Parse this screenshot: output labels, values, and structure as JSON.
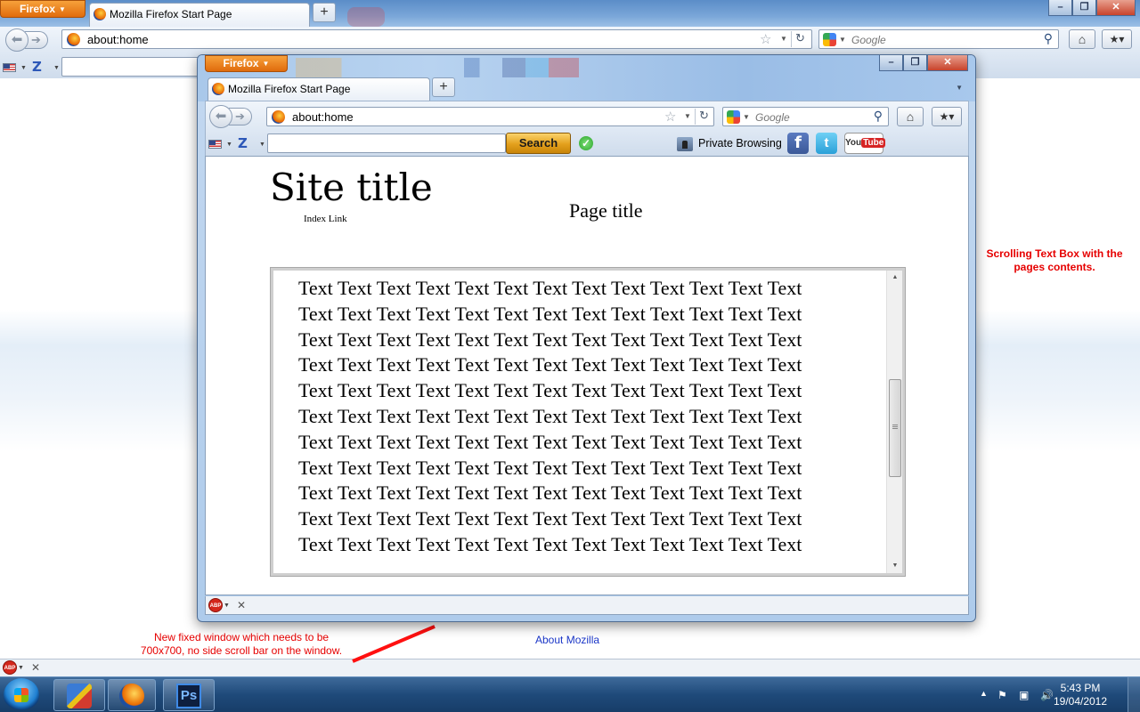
{
  "outer": {
    "firefox_button": "Firefox",
    "tab_label": "Mozilla Firefox Start Page",
    "url": "about:home",
    "search_placeholder": "Google",
    "about_link": "About Mozilla",
    "abp_label": "ABP"
  },
  "inner": {
    "firefox_button": "Firefox",
    "tab_label": "Mozilla Firefox Start Page",
    "url": "about:home",
    "search_placeholder": "Google",
    "toolbar_search_button": "Search",
    "private_browsing": "Private Browsing",
    "abp_label": "ABP",
    "page": {
      "site_title": "Site title",
      "index_link": "Index Link",
      "page_title": "Page title",
      "text_lines": [
        "Text Text Text Text Text Text Text Text Text Text Text Text Text",
        "Text Text Text Text Text Text Text Text Text Text Text Text Text",
        "Text Text Text Text Text Text Text Text Text Text Text Text Text",
        "Text Text Text Text Text Text Text Text Text Text Text Text Text",
        "Text Text Text Text Text Text Text Text Text Text Text Text Text",
        "Text Text Text Text Text Text Text Text Text Text Text Text Text",
        "Text Text Text Text Text Text Text Text Text Text Text Text Text",
        "Text Text Text Text Text Text Text Text Text Text Text Text Text",
        "Text Text Text Text Text Text Text Text Text Text Text Text Text",
        "Text Text Text Text Text Text Text Text Text Text Text Text Text",
        "Text Text Text Text Text Text Text Text Text Text Text Text Text"
      ]
    }
  },
  "annotations": {
    "scroll_box_note": "Scrolling Text Box with the pages contents.",
    "window_note": "New fixed window which needs to be 700x700, no side scroll bar on the window."
  },
  "taskbar": {
    "ps_label": "Ps",
    "time": "5:43 PM",
    "date": "19/04/2012"
  },
  "colors": {
    "annotation": "#e60000",
    "link": "#1a36c7",
    "firefox_orange": "#e06b0c"
  }
}
